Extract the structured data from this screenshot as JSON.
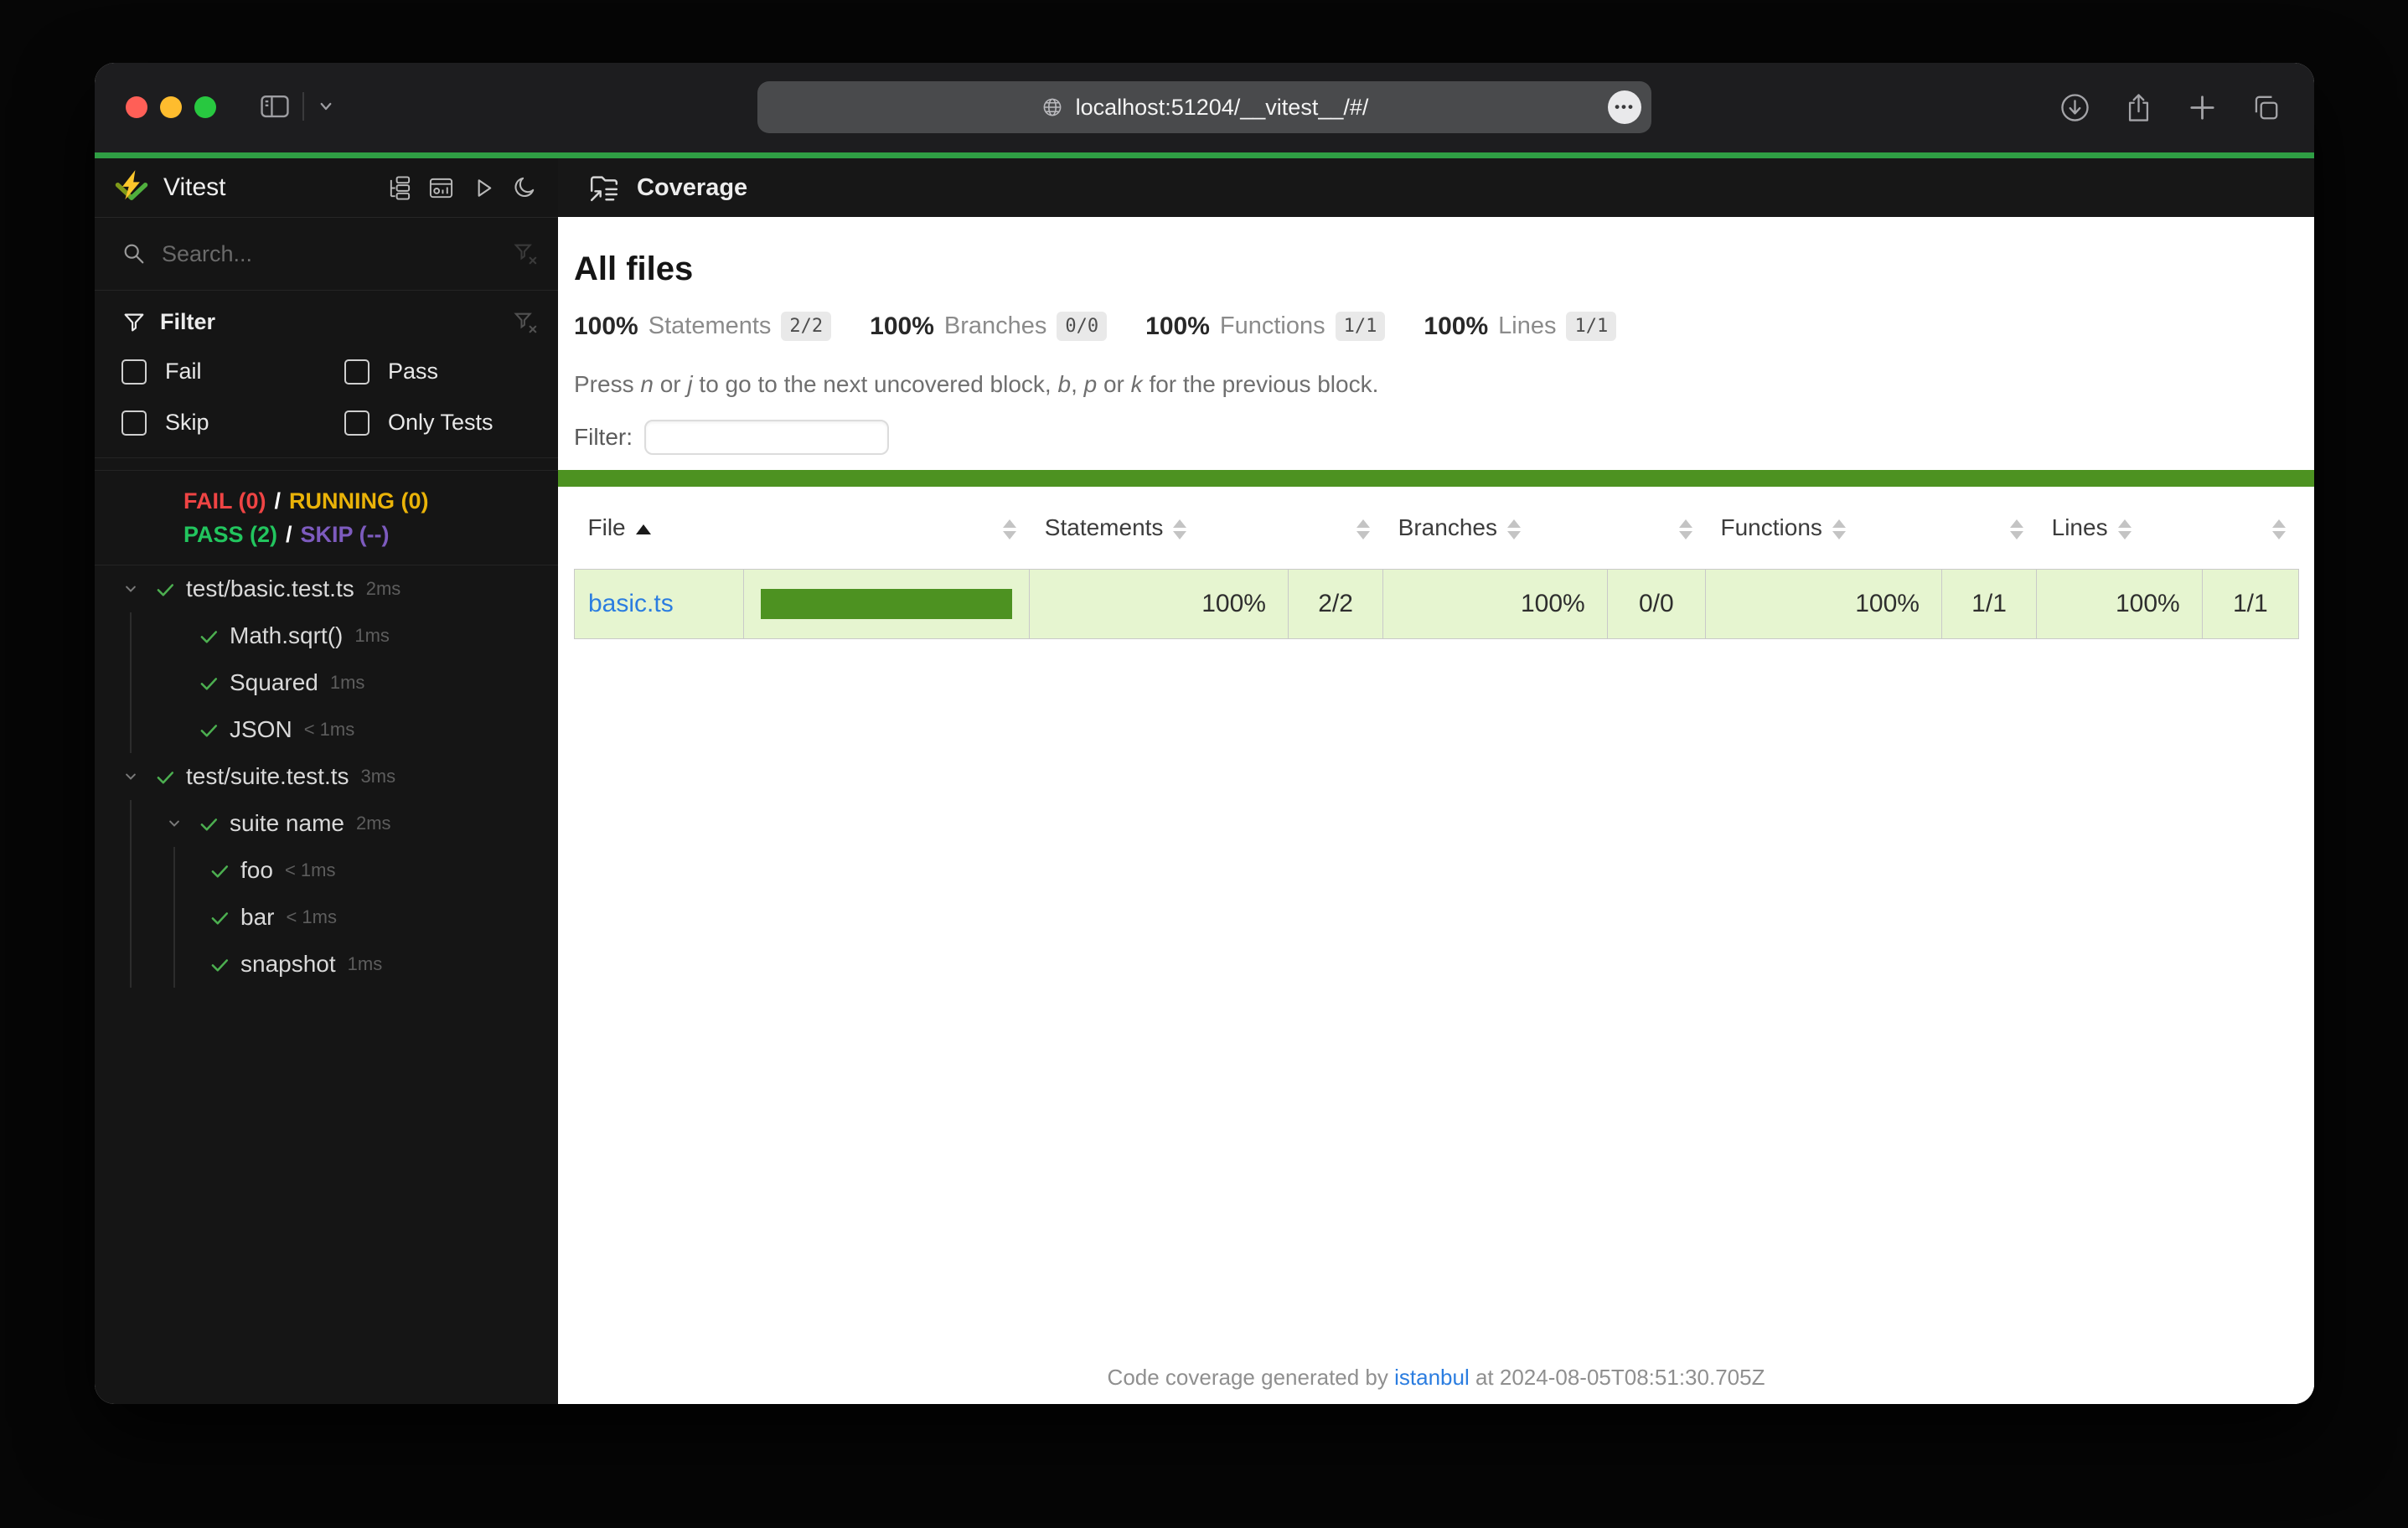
{
  "browser": {
    "url": "localhost:51204/__vitest__/#/"
  },
  "sidebar": {
    "title": "Vitest",
    "search_placeholder": "Search...",
    "filter": {
      "title": "Filter",
      "options": [
        "Fail",
        "Pass",
        "Skip",
        "Only Tests"
      ]
    },
    "status": {
      "fail": "FAIL (0)",
      "running": "RUNNING (0)",
      "pass": "PASS (2)",
      "skip": "SKIP (--)",
      "separator": "/"
    },
    "tree": [
      {
        "label": "test/basic.test.ts",
        "duration": "2ms"
      },
      {
        "label": "Math.sqrt()",
        "duration": "1ms"
      },
      {
        "label": "Squared",
        "duration": "1ms"
      },
      {
        "label": "JSON",
        "duration": "< 1ms"
      },
      {
        "label": "test/suite.test.ts",
        "duration": "3ms"
      },
      {
        "label": "suite name",
        "duration": "2ms"
      },
      {
        "label": "foo",
        "duration": "< 1ms"
      },
      {
        "label": "bar",
        "duration": "< 1ms"
      },
      {
        "label": "snapshot",
        "duration": "1ms"
      }
    ]
  },
  "main": {
    "header_title": "Coverage",
    "page_title": "All files",
    "stats": [
      {
        "pct": "100%",
        "label": "Statements",
        "fraction": "2/2"
      },
      {
        "pct": "100%",
        "label": "Branches",
        "fraction": "0/0"
      },
      {
        "pct": "100%",
        "label": "Functions",
        "fraction": "1/1"
      },
      {
        "pct": "100%",
        "label": "Lines",
        "fraction": "1/1"
      }
    ],
    "hint": {
      "s0": "Press ",
      "s1": "n",
      "s2": " or ",
      "s3": "j",
      "s4": " to go to the next uncovered block, ",
      "s5": "b",
      "s6": ", ",
      "s7": "p",
      "s8": " or ",
      "s9": "k",
      "s10": " for the previous block."
    },
    "filter_label": "Filter:",
    "filter_value": "",
    "table": {
      "columns": {
        "file": "File",
        "statements": "Statements",
        "branches": "Branches",
        "functions": "Functions",
        "lines": "Lines"
      },
      "sort_column": "File",
      "sort_direction": "asc",
      "row": {
        "file": "basic.ts",
        "bar_pct": 100,
        "coverage_class": "high",
        "statements_pct": "100%",
        "statements_frac": "2/2",
        "branches_pct": "100%",
        "branches_frac": "0/0",
        "functions_pct": "100%",
        "functions_frac": "1/1",
        "lines_pct": "100%",
        "lines_frac": "1/1"
      }
    },
    "footer": {
      "prefix": "Code coverage generated by ",
      "link": "istanbul",
      "suffix": " at 2024-08-05T08:51:30.705Z"
    }
  },
  "colors": {
    "accent_green": "#2f9e44",
    "coverage_green": "#4d9221",
    "coverage_high_bg": "#e6f5d0",
    "fail_red": "#ef4444",
    "running_yellow": "#eab308",
    "pass_green": "#22c55e",
    "skip_purple": "#7d5bbe",
    "check_green": "#4caf50",
    "link_blue": "#2b7de0",
    "traffic": [
      "#ff5f57",
      "#febc2e",
      "#28c840"
    ]
  },
  "icons": [
    "close-traffic-icon",
    "minimize-traffic-icon",
    "zoom-traffic-icon",
    "sidebar-toggle-icon",
    "chevron-down-icon",
    "globe-icon",
    "ellipsis-icon",
    "download-icon",
    "share-icon",
    "new-tab-icon",
    "tab-overview-icon",
    "vitest-logo",
    "list-tree-icon",
    "dashboard-icon",
    "run-icon",
    "dark-mode-icon",
    "search-icon",
    "clear-filter-icon",
    "funnel-icon",
    "expand-chevron-icon",
    "check-icon",
    "coverage-report-icon",
    "sort-icon",
    "sort-asc-icon"
  ]
}
